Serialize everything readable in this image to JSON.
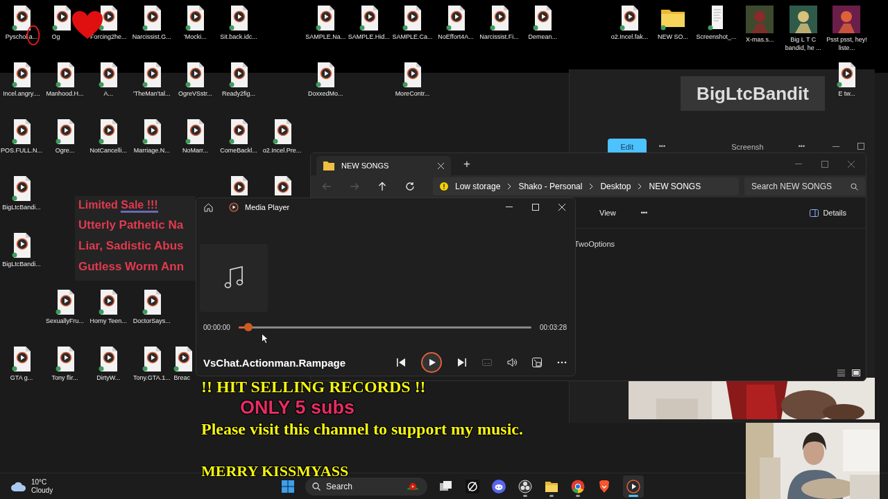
{
  "desktop": {
    "icons": [
      {
        "label": "Pyschol.a...",
        "kind": "video"
      },
      {
        "label": "Og",
        "kind": "video"
      },
      {
        "label": "Forcing2he...",
        "kind": "video"
      },
      {
        "label": "Narcissist.G...",
        "kind": "video"
      },
      {
        "label": "'Mocki...",
        "kind": "video"
      },
      {
        "label": "Sit.back.idc...",
        "kind": "video"
      },
      {
        "label": "SAMPLE.Na...",
        "kind": "video"
      },
      {
        "label": "SAMPLE.Hid...",
        "kind": "video"
      },
      {
        "label": "SAMPLE.Ca...",
        "kind": "video"
      },
      {
        "label": "NoEffort4A...",
        "kind": "video"
      },
      {
        "label": "Narcissist.Fi...",
        "kind": "video"
      },
      {
        "label": "Demean...",
        "kind": "video"
      },
      {
        "label": "o2.Incel.fak...",
        "kind": "video"
      },
      {
        "label": "NEW SO...",
        "kind": "folder"
      },
      {
        "label": "Screenshot_...",
        "kind": "document"
      },
      {
        "label": "X-mas.s..."
      },
      {
        "label": "Big L T C bandid, he ..."
      },
      {
        "label": "Psst psst, hey! liste..."
      },
      {
        "label": "Incel.angry....",
        "kind": "video"
      },
      {
        "label": "Manhood.H...",
        "kind": "video"
      },
      {
        "label": "A...",
        "kind": "video"
      },
      {
        "label": "'TheMan'tal...",
        "kind": "video"
      },
      {
        "label": "OgreVSstr...",
        "kind": "video"
      },
      {
        "label": "Ready2fig...",
        "kind": "video"
      },
      {
        "label": "DoxxedMo...",
        "kind": "video"
      },
      {
        "label": "MoreContr...",
        "kind": "video"
      },
      {
        "label": "E tw...",
        "kind": "video"
      },
      {
        "label": "POS.FULL.N...",
        "kind": "video"
      },
      {
        "label": "Ogre...",
        "kind": "video"
      },
      {
        "label": "NotCancelli...",
        "kind": "video"
      },
      {
        "label": "Marriage.N...",
        "kind": "video"
      },
      {
        "label": "NoMarr...",
        "kind": "video"
      },
      {
        "label": "ComeBackl...",
        "kind": "video"
      },
      {
        "label": "o2.Incel.Pre...",
        "kind": "video"
      },
      {
        "label": "BigLtcBandi...",
        "kind": "video"
      },
      {
        "kind": "video"
      },
      {
        "kind": "video"
      },
      {
        "label": "BigLtcBandi...",
        "kind": "video"
      },
      {
        "label": "SexuallyFru...",
        "kind": "video"
      },
      {
        "label": "Horny Teen...",
        "kind": "video"
      },
      {
        "label": "DoctorSays...",
        "kind": "video"
      },
      {
        "label": "GTA g...",
        "kind": "video"
      },
      {
        "label": "Tony flir...",
        "kind": "video"
      },
      {
        "label": "DirtyW...",
        "kind": "video"
      },
      {
        "label": "Tony.GTA.1...",
        "kind": "video"
      },
      {
        "label": "Breac",
        "kind": "video"
      }
    ]
  },
  "promo": {
    "title_parts": [
      {
        "text": "Limited",
        "underlined": false
      },
      {
        "text": "Sale !!!",
        "underlined": true
      }
    ],
    "lines": [
      "Utterly Pathetic Na",
      "Liar, Sadistic Abus",
      "Gutless Worm Ann"
    ]
  },
  "photos_window": {
    "caption": "BigLtcBandit",
    "edit_button": "Edit",
    "more": "•••",
    "file_name": "Screensh",
    "more_2": "•••"
  },
  "explorer": {
    "tab": "NEW SONGS",
    "new_tab": "+",
    "nav": [
      {
        "kind": "back",
        "disabled": true
      },
      {
        "kind": "forward",
        "disabled": true
      },
      {
        "kind": "up",
        "disabled": false
      },
      {
        "kind": "refresh",
        "disabled": false
      }
    ],
    "storage_warning": "Low storage",
    "breadcrumb": [
      "Shako - Personal",
      "Desktop",
      "NEW SONGS"
    ],
    "search": {
      "placeholder": "Search NEW SONGS"
    },
    "view_button": "View",
    "more": "•••",
    "details_button": "Details",
    "files": [
      "TwoOptions"
    ]
  },
  "media_player": {
    "title": "Media Player",
    "elapsed": "00:00:00",
    "duration": "00:03:28",
    "progress": {
      "level": 0.02
    },
    "track": "VsChat.Actionman.Rampage",
    "controls": [
      {
        "kind": "previous",
        "disabled": false
      },
      {
        "kind": "play",
        "disabled": false
      },
      {
        "kind": "next",
        "disabled": false
      },
      {
        "kind": "subtitles",
        "disabled": true
      },
      {
        "kind": "volume",
        "disabled": false
      },
      {
        "kind": "miniplayer",
        "disabled": false
      },
      {
        "kind": "more",
        "disabled": false
      }
    ]
  },
  "banner": {
    "headline": "!! HIT SELLING RECORDS !!",
    "subs": "ONLY 5 subs",
    "message": "Please visit this channel to support my music.",
    "greeting": "MERRY KISSMYASS"
  },
  "taskbar": {
    "weather": {
      "temperature": "10°C",
      "condition": "Cloudy"
    },
    "search": {
      "placeholder": "Search"
    },
    "apps": [
      {
        "kind": "task-view",
        "running": false,
        "active": false
      },
      {
        "kind": "capcut",
        "running": false,
        "active": false
      },
      {
        "kind": "discord",
        "running": false,
        "active": false
      },
      {
        "kind": "obs",
        "running": true,
        "active": false
      },
      {
        "kind": "folder",
        "running": true,
        "active": false
      },
      {
        "kind": "chrome",
        "running": true,
        "active": false
      },
      {
        "kind": "brave",
        "running": false,
        "active": false
      },
      {
        "kind": "media-player",
        "running": true,
        "active": true
      }
    ]
  }
}
